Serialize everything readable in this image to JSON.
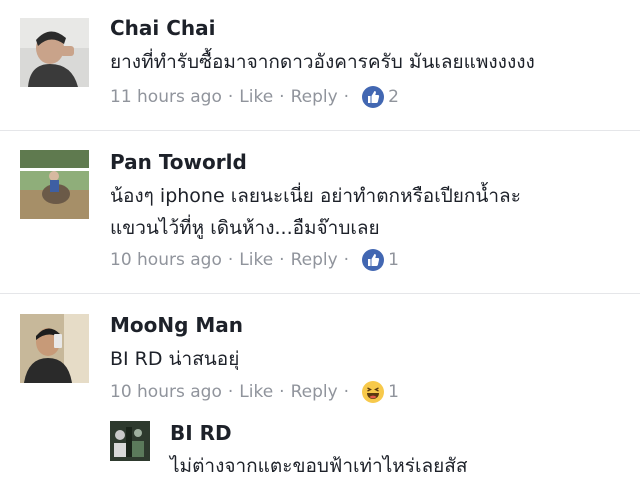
{
  "comments": [
    {
      "name": "Chai Chai",
      "text_lines": [
        "ยางที่ทำรับซื้อมาจากดาวอังคารครับ มันเลยแพงงงงง"
      ],
      "time": "11 hours ago",
      "like_label": "Like",
      "reply_label": "Reply",
      "reaction_icon": "thumbs-up-icon",
      "reaction_count": "2"
    },
    {
      "name": "Pan Toworld",
      "text_lines": [
        "น้องๆ iphone เลยนะเนี่ย อย่าทำตกหรือเปียกน้ำละ",
        "แขวนไว้ที่หู เดินห้าง...อืมจ๊าบเลย"
      ],
      "time": "10 hours ago",
      "like_label": "Like",
      "reply_label": "Reply",
      "reaction_icon": "thumbs-up-icon",
      "reaction_count": "1"
    },
    {
      "name": "MooNg Man",
      "text_lines": [
        "BI RD น่าสนอยุ่"
      ],
      "time": "10 hours ago",
      "like_label": "Like",
      "reply_label": "Reply",
      "reaction_icon": "haha-icon",
      "reaction_count": "1"
    }
  ],
  "reply": {
    "name": "BI RD",
    "text_lines": [
      "ไม่ต่างจากแตะขอบฟ้าเท่าไหร่เลยสัส"
    ]
  },
  "colors": {
    "like_blue": "#4267b2",
    "meta_gray": "#90949c",
    "divider": "#e5e6e9",
    "haha_yellow": "#f7c94b"
  }
}
